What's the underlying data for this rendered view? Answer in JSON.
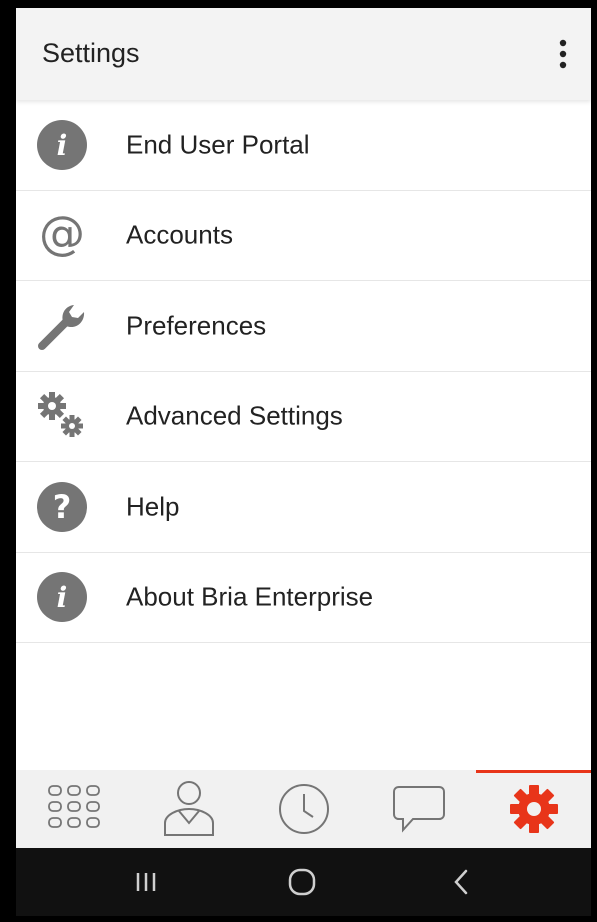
{
  "appbar": {
    "title": "Settings",
    "overflow_icon": "more-vert-icon"
  },
  "settings_items": [
    {
      "label": "End User Portal",
      "icon": "info-icon"
    },
    {
      "label": "Accounts",
      "icon": "at-icon"
    },
    {
      "label": "Preferences",
      "icon": "wrench-icon"
    },
    {
      "label": "Advanced Settings",
      "icon": "gears-icon"
    },
    {
      "label": "Help",
      "icon": "help-icon"
    },
    {
      "label": "About Bria Enterprise",
      "icon": "info-icon"
    }
  ],
  "tabbar": {
    "tabs": [
      {
        "name": "dialpad",
        "icon": "dialpad-icon",
        "active": false
      },
      {
        "name": "contacts",
        "icon": "person-icon",
        "active": false
      },
      {
        "name": "history",
        "icon": "clock-icon",
        "active": false
      },
      {
        "name": "messages",
        "icon": "chat-bubble-icon",
        "active": false
      },
      {
        "name": "settings",
        "icon": "gear-icon",
        "active": true
      }
    ]
  },
  "navbar": {
    "buttons": [
      "recent-apps-icon",
      "home-icon",
      "back-icon"
    ]
  },
  "colors": {
    "accent": "#e8351a",
    "icon_gray": "#757575",
    "appbar_bg": "#f3f3f3",
    "tabbar_bg": "#f1f1f1"
  }
}
